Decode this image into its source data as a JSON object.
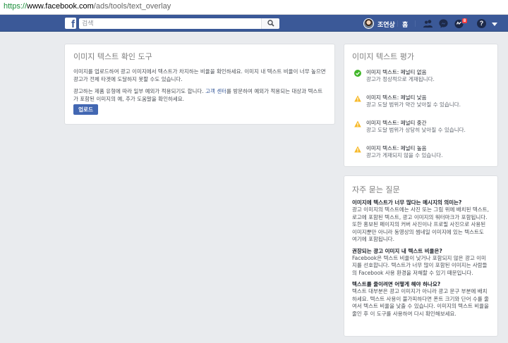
{
  "browser": {
    "url_scheme": "https://",
    "url_host": "www.facebook.com",
    "url_path": "/ads/tools/text_overlay"
  },
  "topbar": {
    "logo": "f",
    "search_placeholder": "검색",
    "username": "조연상",
    "home": "홈",
    "notification_count": "8",
    "help": "?",
    "icons": [
      "search-icon",
      "friends-icon",
      "messenger-icon",
      "notifications-icon",
      "help-icon",
      "caret-down-icon"
    ]
  },
  "tool": {
    "title": "이미지 텍스트 확인 도구",
    "p1": "이미지를 업로드하여 광고 이미지에서 텍스트가 차지하는 비율을 확인하세요. 이미지 내 텍스트 비율이 너무 높으면 광고가 전체 타겟에 도달하지 못할 수도 있습니다.",
    "p2_before": "광고하는 제품 유형에 따라 일부 예외가 적용되기도 합니다. ",
    "p2_link": "고객 센터",
    "p2_after": "를 방문하여 예외가 적용되는 대상과 텍스트가 포함된 이미지의 예, 추가 도움말을 확인하세요.",
    "upload_button": "업로드"
  },
  "rating": {
    "title": "이미지 텍스트 평가",
    "items": [
      {
        "icon": "check-circle-icon",
        "title": "이미지 텍스트: 페널티 없음",
        "desc": "광고가 정상적으로 게재됩니다."
      },
      {
        "icon": "warning-icon",
        "title": "이미지 텍스트: 페널티 낮음",
        "desc": "광고 도달 범위가 약간 낮아질 수 있습니다."
      },
      {
        "icon": "warning-icon",
        "title": "이미지 텍스트: 페널티 중간",
        "desc": "광고 도달 범위가 상당히 낮아질 수 있습니다."
      },
      {
        "icon": "warning-icon",
        "title": "이미지 텍스트: 페널티 높음",
        "desc": "광고가 게재되지 않을 수 있습니다."
      }
    ],
    "colors": {
      "ok": "#42b72a",
      "warn": "#f7b928"
    }
  },
  "faq": {
    "title": "자주 묻는 질문",
    "items": [
      {
        "q": "이미지에 텍스트가 너무 많다는 메시지의 의미는?",
        "a": "광고 이미지의 텍스트에는 사진 또는 그림 위에 배치된 텍스트, 로고에 포함된 텍스트, 광고 이미지의 워터마크가 포함됩니다. 또한 홍보된 페이지의 커버 사진이나 프로필 사진으로 사용된 이미지뿐만 아니라 동영상의 썸네일 이미지에 있는 텍스트도 여기에 포함됩니다."
      },
      {
        "q": "권장되는 광고 이미지 내 텍스트 비율은?",
        "a": "Facebook은 텍스트 비율이 낮거나 포함되지 않은 광고 이미지를 선호합니다. 텍스트가 너무 많이 포함된 이미지는 사람들의 Facebook 사용 환경을 저해할 수 있기 때문입니다."
      },
      {
        "q": "텍스트를 줄이려면 어떻게 해야 하나요?",
        "a": "텍스트 대부분은 광고 이미지가 아니라 광고 문구 부분에 배치하세요. 텍스트 사용이 불가피하다면 폰트 크기와 단어 수를 줄여서 텍스트 비율을 낮출 수 있습니다. 이미지의 텍스트 비율을 줄인 후 이 도구를 사용하여 다시 확인해보세요."
      }
    ]
  },
  "colors": {
    "topbar": "#3b5998",
    "button": "#4267b2",
    "link": "#365899",
    "page_bg": "#e9ebee"
  }
}
